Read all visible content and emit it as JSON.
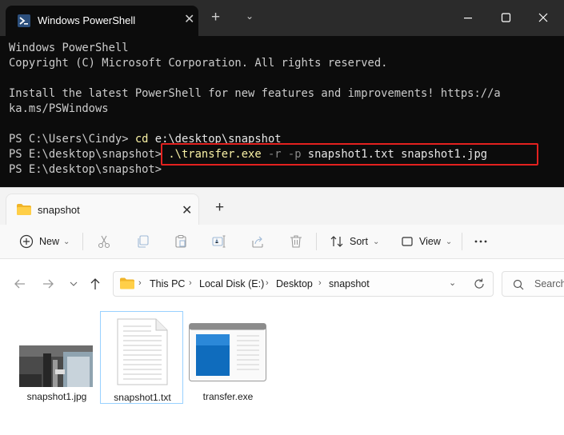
{
  "powershell": {
    "tab_title": "Windows PowerShell",
    "icons": {
      "tab": "powershell-icon",
      "close": "close-icon",
      "new_tab": "plus-icon",
      "dropdown": "chevron-down-icon"
    },
    "lines": [
      "Windows PowerShell",
      "Copyright (C) Microsoft Corporation. All rights reserved.",
      "",
      "Install the latest PowerShell for new features and improvements! https://a",
      "ka.ms/PSWindows",
      ""
    ],
    "prompt1": "PS C:\\Users\\Cindy> ",
    "cmd1_verb": "cd",
    "cmd1_arg": " e:\\desktop\\snapshot",
    "prompt2": "PS E:\\desktop\\snapshot> ",
    "cmd2_exe": ".\\transfer.exe",
    "cmd2_flags": " -r -p",
    "cmd2_args": " snapshot1.txt snapshot1.jpg",
    "prompt3": "PS E:\\desktop\\snapshot> ",
    "highlight_color": "#e3211f"
  },
  "explorer": {
    "tab_title": "snapshot",
    "toolbar": {
      "new_label": "New",
      "sort_label": "Sort",
      "view_label": "View",
      "icons": [
        "cut-icon",
        "copy-icon",
        "paste-icon",
        "rename-icon",
        "share-icon",
        "delete-icon"
      ]
    },
    "address": {
      "crumbs": [
        "This PC",
        "Local Disk (E:)",
        "Desktop",
        "snapshot"
      ]
    },
    "search_placeholder": "Search",
    "files": [
      {
        "name": "snapshot1.jpg",
        "icon": "image-thumbnail"
      },
      {
        "name": "snapshot1.txt",
        "icon": "text-file-icon"
      },
      {
        "name": "transfer.exe",
        "icon": "exe-file-icon"
      }
    ],
    "accent_color": "#0067c0"
  }
}
